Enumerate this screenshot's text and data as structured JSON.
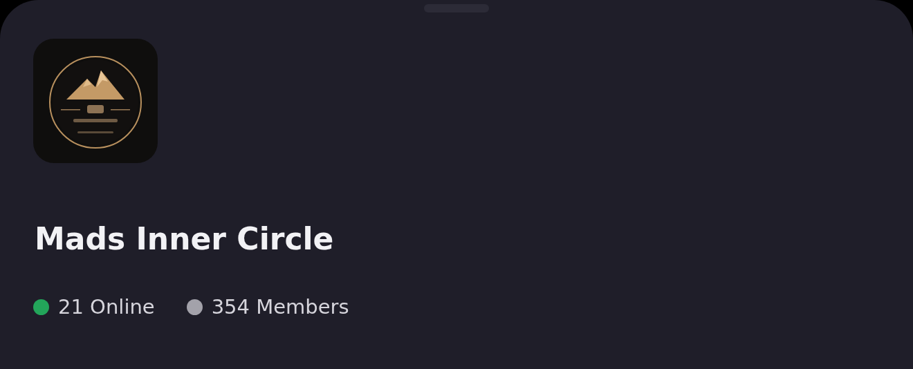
{
  "server": {
    "name": "Mads Inner Circle"
  },
  "stats": [
    {
      "text": "21 Online",
      "color": "#23a55a"
    },
    {
      "text": "354 Members",
      "color": "#a3a2aa"
    }
  ]
}
